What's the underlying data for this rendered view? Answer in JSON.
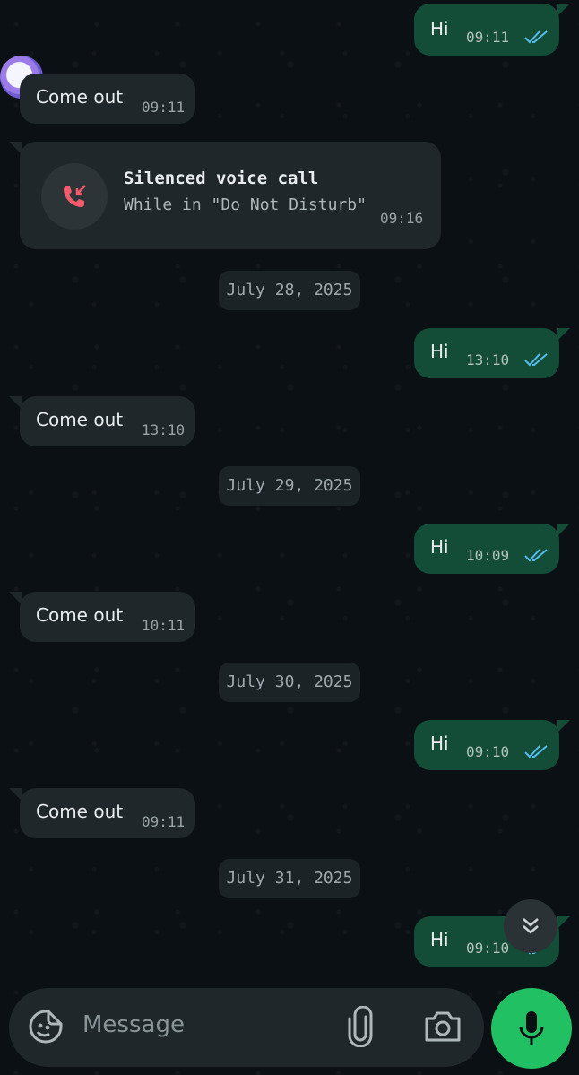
{
  "messages": [
    {
      "dir": "out",
      "text": "Hi",
      "time": "09:11",
      "ticks": "read"
    },
    {
      "dir": "in",
      "text": "Come out",
      "time": "09:11"
    },
    {
      "dir": "out",
      "text": "Hi",
      "time": "13:10",
      "ticks": "read"
    },
    {
      "dir": "in",
      "text": "Come out",
      "time": "13:10"
    },
    {
      "dir": "out",
      "text": "Hi",
      "time": "10:09",
      "ticks": "read"
    },
    {
      "dir": "in",
      "text": "Come out",
      "time": "10:11"
    },
    {
      "dir": "out",
      "text": "Hi",
      "time": "09:10",
      "ticks": "read"
    },
    {
      "dir": "in",
      "text": "Come out",
      "time": "09:11"
    },
    {
      "dir": "out",
      "text": "Hi",
      "time": "09:10",
      "ticks": "read"
    }
  ],
  "call": {
    "title": "Silenced voice call",
    "subtitle": "While in \"Do Not Disturb\"",
    "time": "09:16",
    "icon": "missed-call-icon"
  },
  "dates": [
    "July 28, 2025",
    "July 29, 2025",
    "July 30, 2025",
    "July 31, 2025"
  ],
  "input": {
    "placeholder": "Message"
  },
  "icons": {
    "emoji": "sticker-icon",
    "attach": "paperclip-icon",
    "camera": "camera-icon",
    "mic": "microphone-icon",
    "scroll": "double-chevron-down-icon",
    "avatar": "avatar"
  },
  "colors": {
    "outgoing": "#144d37",
    "incoming": "#1f272a",
    "accent": "#21c063",
    "tick": "#53bdeb",
    "missed": "#f15c6d"
  }
}
